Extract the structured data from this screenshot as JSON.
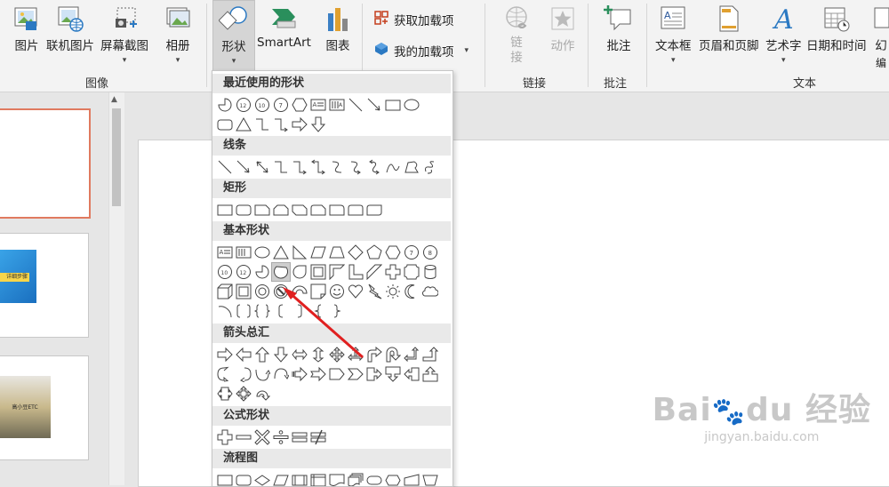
{
  "ribbon": {
    "images_group": {
      "label": "图像",
      "picture": "图片",
      "online_picture": "联机图片",
      "screenshot": "屏幕截图",
      "album": "相册"
    },
    "illustrations": {
      "shapes": "形状",
      "smartart": "SmartArt",
      "chart": "图表"
    },
    "addins": {
      "get_addins": "获取加载项",
      "my_addins": "我的加载项"
    },
    "links_group": {
      "label": "链接",
      "link": "链\n接",
      "action": "动作"
    },
    "comments_group": {
      "label": "批注",
      "comment": "批注"
    },
    "text_group": {
      "label": "文本",
      "textbox": "文本框",
      "header_footer": "页眉和页脚",
      "wordart": "艺术字",
      "datetime": "日期和时间",
      "slide_number": "幻",
      "extra": "编"
    },
    "colors": {
      "accent": "#c43e1c",
      "office_blue": "#2b579a",
      "red_arrow": "#e02020"
    }
  },
  "gallery": {
    "categories": {
      "recent": "最近使用的形状",
      "lines": "线条",
      "rect": "矩形",
      "basic": "基本形状",
      "arrows": "箭头总汇",
      "equation": "公式形状",
      "flowchart": "流程图"
    },
    "labels": {
      "n12": "12",
      "n10": "10",
      "n7": "7",
      "n8": "8"
    }
  },
  "thumbnails": {
    "thumb2_text": "详细步骤",
    "thumb3_text": "高小豆ETC"
  },
  "watermark": {
    "brand": "Bai",
    "brand2": "du",
    "cn": "经验",
    "url": "jingyan.baidu.com"
  }
}
